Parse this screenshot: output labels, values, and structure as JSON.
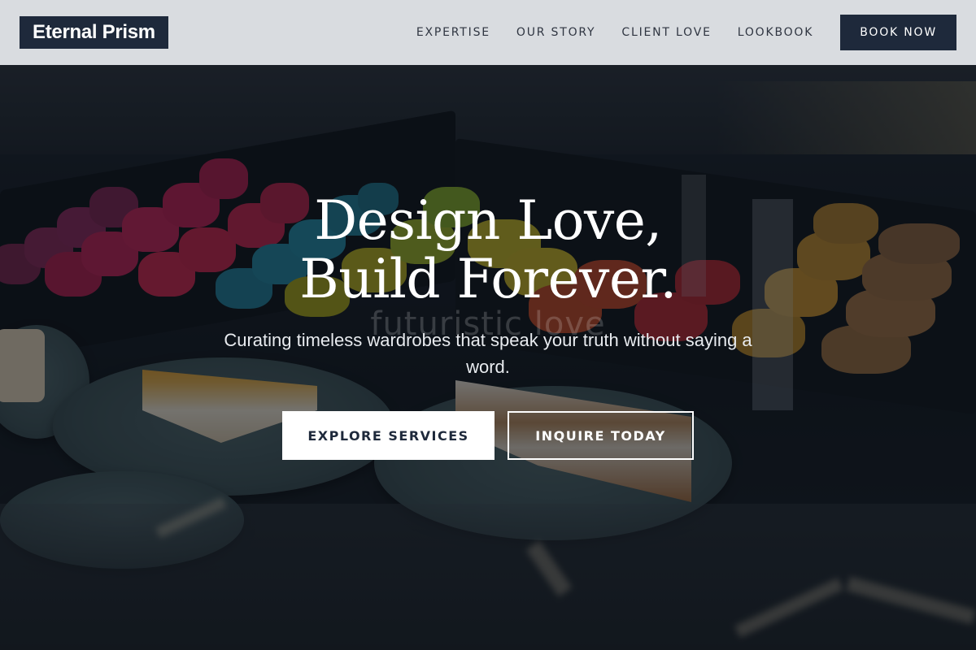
{
  "brand": {
    "logo_text": "Eternal Prism"
  },
  "nav": {
    "items": [
      {
        "label": "EXPERTISE"
      },
      {
        "label": "OUR STORY"
      },
      {
        "label": "CLIENT LOVE"
      },
      {
        "label": "LOOKBOOK"
      }
    ],
    "cta_label": "BOOK NOW"
  },
  "hero": {
    "title_line1": "Design Love,",
    "title_line2": "Build Forever.",
    "subtitle": "Curating timeless wardrobes that speak your truth without saying a word.",
    "watermark": "futuristic love",
    "primary_button": "EXPLORE SERVICES",
    "secondary_button": "INQUIRE TODAY"
  },
  "colors": {
    "brand_dark": "#1e293b",
    "header_bg": "#e2e4e8",
    "white": "#ffffff"
  }
}
